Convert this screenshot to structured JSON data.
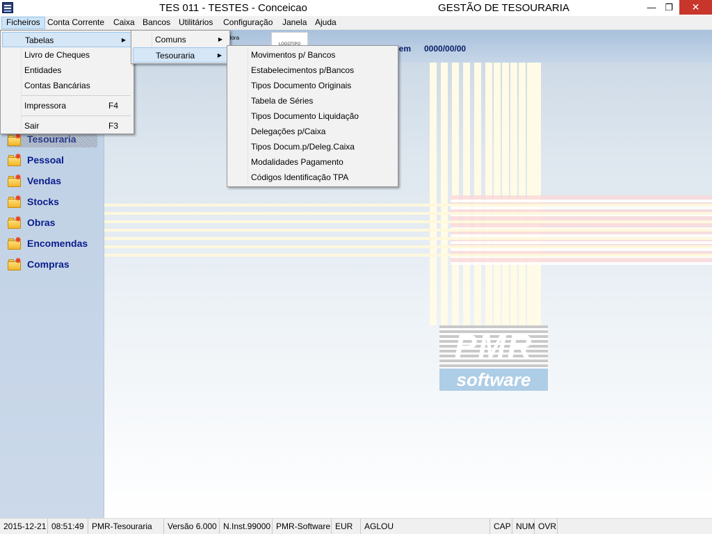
{
  "window": {
    "title": "TES 011 - TESTES - Conceicao",
    "app_name": "GESTÃO DE TESOURARIA",
    "minimize": "—",
    "restore": "❐",
    "close": "✕"
  },
  "menubar": [
    "Ficheiros",
    "Conta Corrente",
    "Caixa",
    "Bancos",
    "Utilitários",
    "Configuração",
    "Janela",
    "Ajuda"
  ],
  "header": {
    "small_label": "dora",
    "logo_text": "LOGOTIPO",
    "date_label": "ca em",
    "date_value": "0000/00/00"
  },
  "sidebar": {
    "items": [
      "Tesouraria",
      "Pessoal",
      "Vendas",
      "Stocks",
      "Obras",
      "Encomendas",
      "Compras"
    ],
    "selected": "Tesouraria"
  },
  "menu_ficheiros": {
    "items": [
      {
        "label": "Tabelas",
        "shortcut": "",
        "submenu": true
      },
      {
        "label": "Livro de Cheques",
        "shortcut": ""
      },
      {
        "label": "Entidades",
        "shortcut": ""
      },
      {
        "label": "Contas Bancárias",
        "shortcut": ""
      },
      {
        "label": "Impressora",
        "shortcut": "F4"
      },
      {
        "label": "Sair",
        "shortcut": "F3"
      }
    ]
  },
  "menu_tabelas": {
    "items": [
      {
        "label": "Comuns",
        "submenu": true
      },
      {
        "label": "Tesouraria",
        "submenu": true
      }
    ]
  },
  "menu_tesouraria": {
    "items": [
      "Movimentos p/ Bancos",
      "Estabelecimentos p/Bancos",
      "Tipos Documento Originais",
      "Tabela de Séries",
      "Tipos Documento Liquidação",
      "Delegações p/Caixa",
      "Tipos Docum.p/Deleg.Caixa",
      "Modalidades Pagamento",
      "Códigos Identificação TPA"
    ]
  },
  "logo": {
    "brand": "PMR",
    "tagline": "software"
  },
  "statusbar": {
    "date": "2015-12-21",
    "time": "08:51:49",
    "module": "PMR-Tesouraria",
    "version": "Versão  6.000",
    "instance": "N.Inst.99000",
    "vendor": "PMR-Software",
    "currency": "EUR",
    "user": "AGLOU",
    "caps": "CAP",
    "num": "NUM",
    "ovr": "OVR"
  },
  "colors": {
    "sidebar_text": "#0a1c8c",
    "close_button": "#c7352b",
    "menu_highlight": "#cce4f7"
  }
}
